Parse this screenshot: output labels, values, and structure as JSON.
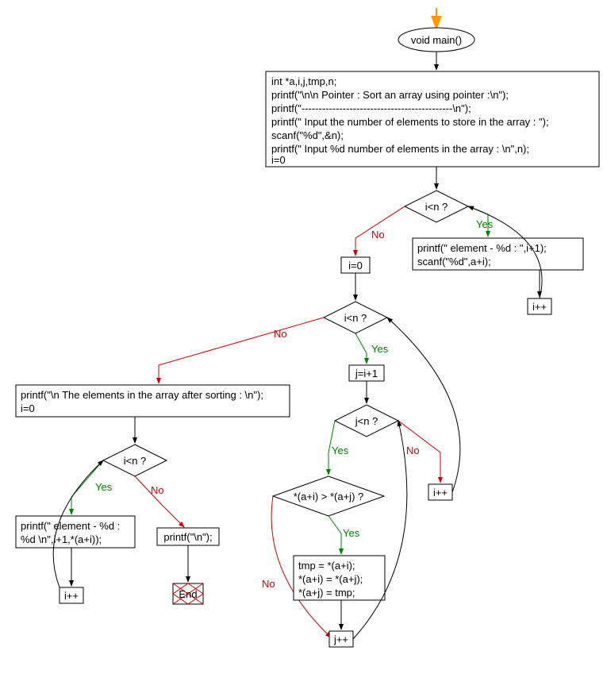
{
  "chart_data": {
    "type": "flowchart",
    "nodes": {
      "main": "void main()",
      "init_l1": "int *a,i,j,tmp,n;",
      "init_l2": "printf(\"\\n\\n Pointer : Sort an array using pointer :\\n\");",
      "init_l3": "printf(\"--------------------------------------------\\n\");",
      "init_l4": "printf(\" Input the number of elements to store in the array : \");",
      "init_l5": "scanf(\"%d\",&n);",
      "init_l6": "printf(\" Input %d number of elements in the array : \\n\",n);",
      "init_l7": "i=0",
      "cond1": "i<n ?",
      "read_l1": "printf(\" element - %d : \",i+1);",
      "read_l2": "scanf(\"%d\",a+i);",
      "inc_i1": "i++",
      "reset_i": "i=0",
      "cond2": "i<n ?",
      "set_j": "j=i+1",
      "cond3": "j<n ?",
      "cond4": "*(a+i) > *(a+j) ?",
      "swap_l1": "tmp = *(a+i);",
      "swap_l2": "*(a+i) = *(a+j);",
      "swap_l3": "*(a+j) = tmp;",
      "inc_j": "j++",
      "inc_i2": "i++",
      "after_l1": "printf(\"\\n The elements in the array after sorting : \\n\");",
      "after_l2": "i=0",
      "cond5": "i<n ?",
      "print_l1": "printf(\" element - %d :",
      "print_l2": " %d \\n\",i+1,*(a+i));",
      "inc_i3": "i++",
      "final": "printf(\"\\n\");",
      "end": "End"
    },
    "labels": {
      "yes": "Yes",
      "no": "No"
    }
  }
}
